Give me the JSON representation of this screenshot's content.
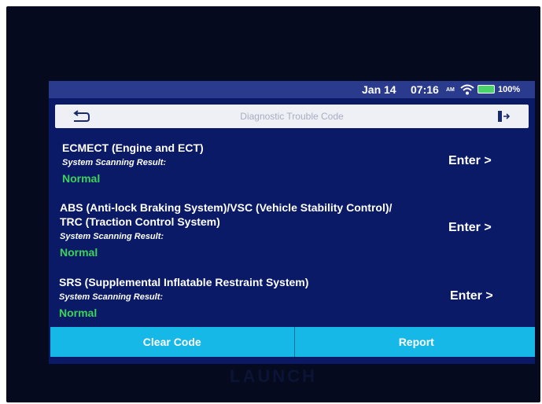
{
  "status_bar": {
    "date": "Jan 14",
    "time": "07:16",
    "ampm": "AM",
    "battery": "100%",
    "icons": [
      "wifi-icon",
      "battery-icon"
    ]
  },
  "title_bar": {
    "title": "Diagnostic Trouble Code",
    "icons": [
      "back-arrow-icon",
      "exit-icon"
    ]
  },
  "systems": [
    {
      "name_lines": [
        "ECMECT (Engine and ECT)"
      ],
      "label": "System Scanning Result:",
      "result": "Normal",
      "action": "Enter >"
    },
    {
      "name_lines": [
        "ABS (Anti-lock Braking System)/VSC (Vehicle Stability Control)/",
        "TRC (Traction Control System)"
      ],
      "label": "System Scanning Result:",
      "result": "Normal",
      "action": "Enter >"
    },
    {
      "name_lines": [
        "SRS (Supplemental Inflatable Restraint System)"
      ],
      "label": "System Scanning Result:",
      "result": "Normal",
      "action": "Enter >"
    }
  ],
  "buttons": {
    "clear_code": "Clear Code",
    "report": "Report"
  },
  "device_brand": "LAUNCH",
  "colors": {
    "screen_bg": "#0a1a66",
    "status_bar": "#2a3a8c",
    "button": "#16b8e8",
    "result_green": "#3bd35a"
  }
}
